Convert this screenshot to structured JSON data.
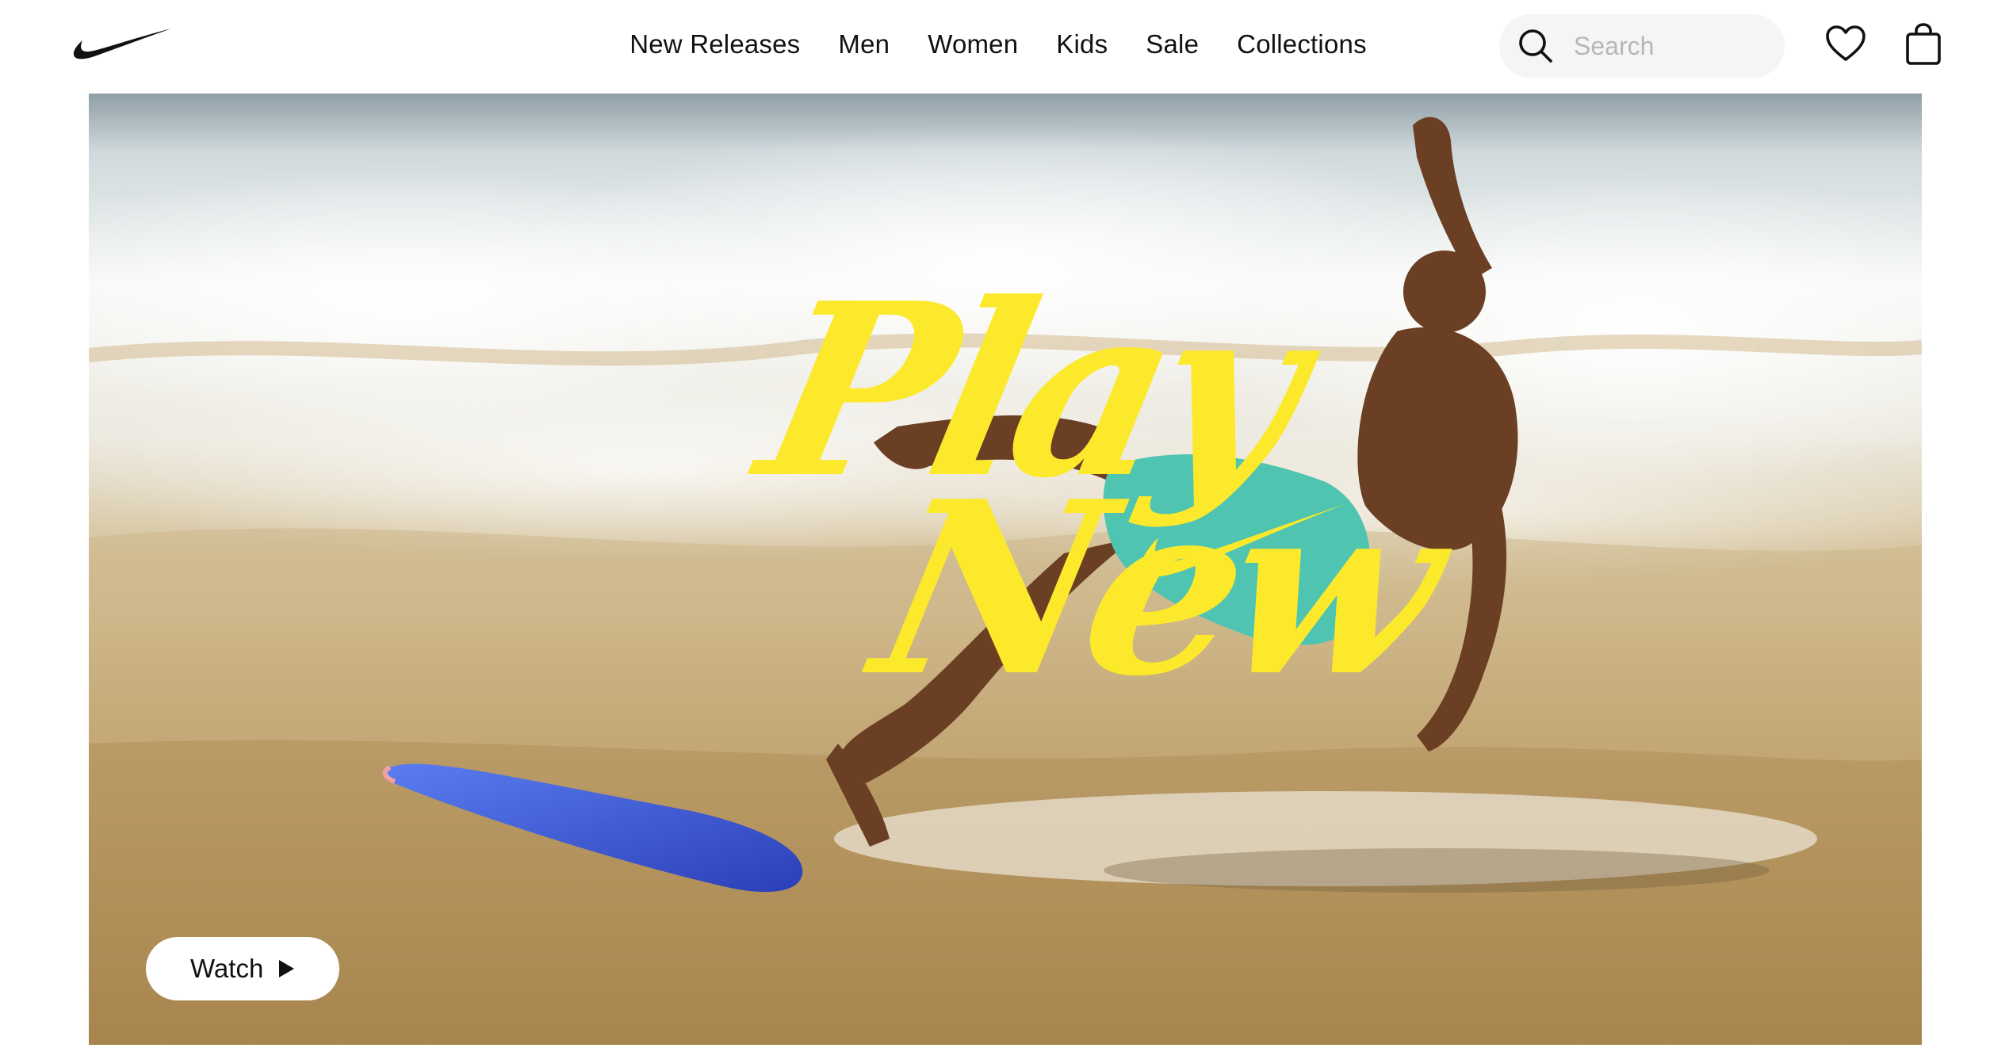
{
  "brand": {
    "logo": "nike-swoosh-logo",
    "accent": "#fde92b"
  },
  "nav": {
    "items": [
      {
        "label": "New Releases"
      },
      {
        "label": "Men"
      },
      {
        "label": "Women"
      },
      {
        "label": "Kids"
      },
      {
        "label": "Sale"
      },
      {
        "label": "Collections"
      }
    ]
  },
  "search": {
    "placeholder": "Search",
    "value": "",
    "icon": "search-icon"
  },
  "actions": {
    "favorites_icon": "heart-icon",
    "bag_icon": "shopping-bag-icon"
  },
  "hero": {
    "headline_line1": "Play",
    "headline_line2": "New",
    "headline_color": "#fde92b",
    "watch_label": "Watch",
    "watch_icon": "play-icon"
  }
}
